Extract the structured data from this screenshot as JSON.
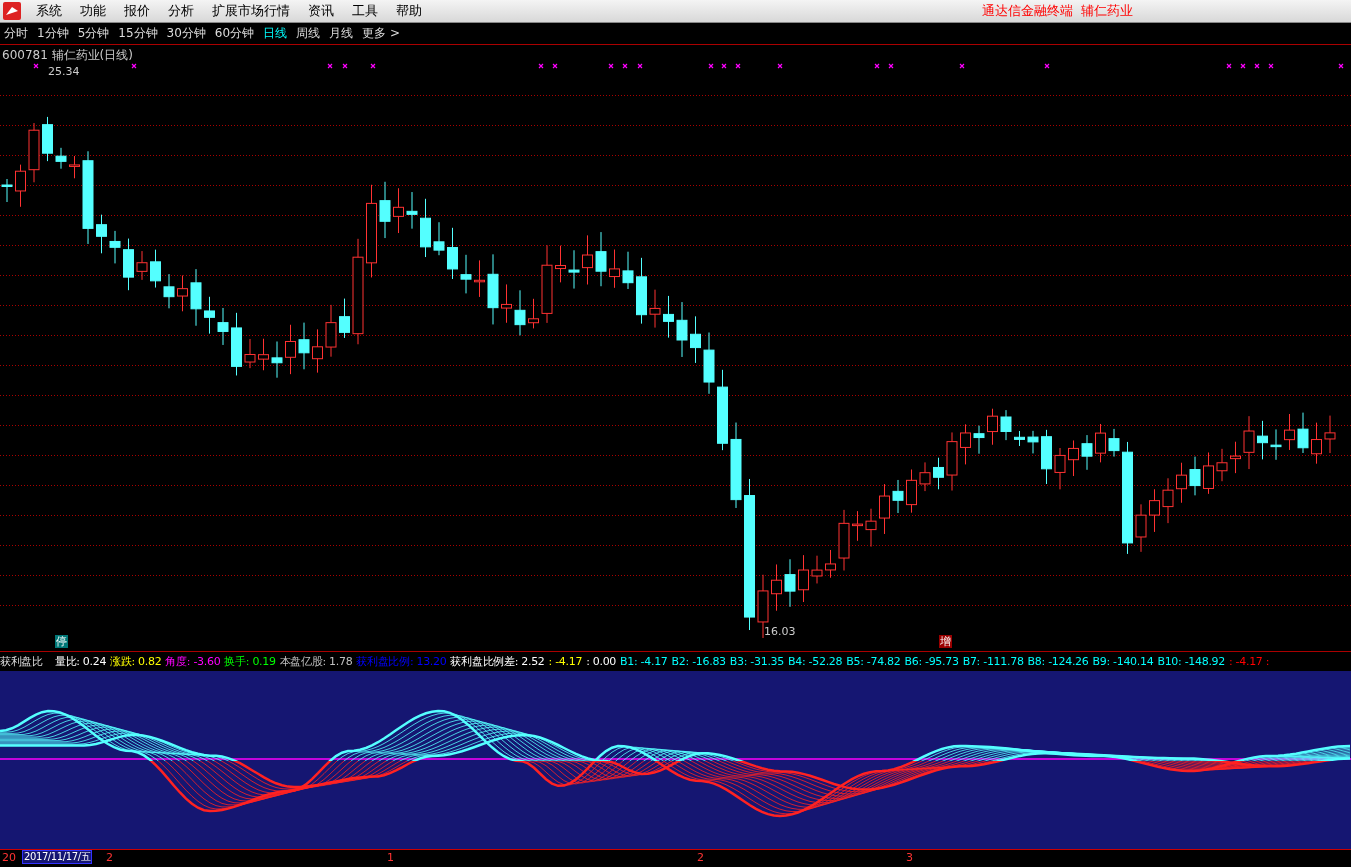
{
  "menu": {
    "items": [
      "系统",
      "功能",
      "报价",
      "分析",
      "扩展市场行情",
      "资讯",
      "工具",
      "帮助"
    ],
    "title_right": [
      "通达信金融终端",
      "辅仁药业"
    ]
  },
  "periods": [
    {
      "label": "分时",
      "selected": false
    },
    {
      "label": "1分钟",
      "selected": false
    },
    {
      "label": "5分钟",
      "selected": false
    },
    {
      "label": "15分钟",
      "selected": false
    },
    {
      "label": "30分钟",
      "selected": false
    },
    {
      "label": "60分钟",
      "selected": false
    },
    {
      "label": "日线",
      "selected": true
    },
    {
      "label": "周线",
      "selected": false
    },
    {
      "label": "月线",
      "selected": false
    },
    {
      "label": "更多 >",
      "selected": false
    }
  ],
  "chart": {
    "title": "600781 辅仁药业(日线)",
    "high_label": "25.34",
    "low_label": "16.03",
    "markers": [
      "停",
      "增"
    ]
  },
  "indicator": {
    "name": "获利盘比",
    "items": [
      {
        "text": "量比: 0.24",
        "color": "#ffffff"
      },
      {
        "text": "涨跌: 0.82",
        "color": "#ffff00"
      },
      {
        "text": "角度: -3.60",
        "color": "#ff00ff"
      },
      {
        "text": "换手: 0.19",
        "color": "#00ff00"
      },
      {
        "text": "本盘亿股: 1.78",
        "color": "#c0c0c0"
      },
      {
        "text": "获利盘比例: 13.20",
        "color": "#0000ff"
      },
      {
        "text": "获利盘比例差: 2.52",
        "color": "#ffffff"
      },
      {
        "text": ": -4.17",
        "color": "#ffff00"
      },
      {
        "text": ": 0.00",
        "color": "#ffffff"
      },
      {
        "text": "B1: -4.17",
        "color": "#00ffff"
      },
      {
        "text": "B2: -16.83",
        "color": "#00ffff"
      },
      {
        "text": "B3: -31.35",
        "color": "#00ffff"
      },
      {
        "text": "B4: -52.28",
        "color": "#00ffff"
      },
      {
        "text": "B5: -74.82",
        "color": "#00ffff"
      },
      {
        "text": "B6: -95.73",
        "color": "#00ffff"
      },
      {
        "text": "B7: -111.78",
        "color": "#00ffff"
      },
      {
        "text": "B8: -124.26",
        "color": "#00ffff"
      },
      {
        "text": "B9: -140.14",
        "color": "#00ffff"
      },
      {
        "text": "B10: -148.92",
        "color": "#00ffff"
      },
      {
        "text": ": -4.17 :",
        "color": "#ff0000"
      }
    ]
  },
  "axis": {
    "start": "20",
    "date": "2017/11/17/五",
    "ticks": [
      "2",
      "1",
      "2",
      "3"
    ]
  }
}
